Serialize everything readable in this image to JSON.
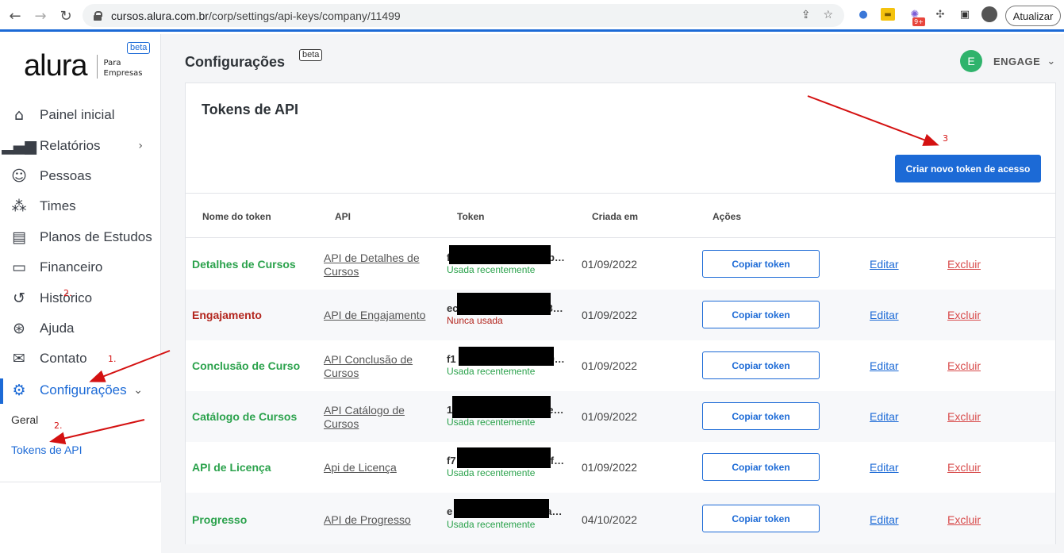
{
  "browser": {
    "url_host": "cursos.alura.com.br",
    "url_path": "/corp/settings/api-keys/company/11499",
    "update_label": "Atualizar",
    "ext_badge": "9+"
  },
  "sidebar": {
    "logo_word": "alura",
    "logo_sub_1": "Para",
    "logo_sub_2": "Empresas",
    "beta": "beta",
    "items": [
      {
        "label": "Painel inicial"
      },
      {
        "label": "Relatórios"
      },
      {
        "label": "Pessoas"
      },
      {
        "label": "Times"
      },
      {
        "label": "Planos de Estudos"
      },
      {
        "label": "Financeiro"
      },
      {
        "label": "Histórico"
      },
      {
        "label": "Ajuda"
      },
      {
        "label": "Contato"
      },
      {
        "label": "Configurações"
      }
    ],
    "sub_items": [
      {
        "label": "Geral"
      },
      {
        "label": "Tokens de API"
      }
    ]
  },
  "header": {
    "title": "Configurações",
    "beta": "beta",
    "avatar_initial": "E",
    "user_name": "ENGAGE"
  },
  "card": {
    "title": "Tokens de API",
    "create_button": "Criar novo token de acesso",
    "columns": [
      "Nome do token",
      "API",
      "Token",
      "Criada em",
      "Ações"
    ],
    "rows": [
      {
        "name": "Detalhes de Cursos",
        "api": "API de Detalhes de Cursos",
        "token_start": "f",
        "token_end": "lb…",
        "usage": "Usada recentemente",
        "date": "01/09/2022",
        "copy": "Copiar token",
        "edit": "Editar",
        "delete": "Excluir"
      },
      {
        "name": "Engajamento",
        "api": "API de Engajamento",
        "token_start": "ec",
        "token_end": "8…",
        "usage": "Nunca usada",
        "date": "01/09/2022",
        "copy": "Copiar token",
        "edit": "Editar",
        "delete": "Excluir"
      },
      {
        "name": "Conclusão de Curso",
        "api": "API Conclusão de Cursos",
        "token_start": "f1",
        "token_end": "9…",
        "usage": "Usada recentemente",
        "date": "01/09/2022",
        "copy": "Copiar token",
        "edit": "Editar",
        "delete": "Excluir"
      },
      {
        "name": "Catálogo de Cursos",
        "api": "API Catálogo de Cursos",
        "token_start": "1",
        "token_end": "e…",
        "usage": "Usada recentemente",
        "date": "01/09/2022",
        "copy": "Copiar token",
        "edit": "Editar",
        "delete": "Excluir"
      },
      {
        "name": "API de Licença",
        "api": "Api de Licença",
        "token_start": "f7",
        "token_end": "af…",
        "usage": "Usada recentemente",
        "date": "01/09/2022",
        "copy": "Copiar token",
        "edit": "Editar",
        "delete": "Excluir"
      },
      {
        "name": "Progresso",
        "api": "API de Progresso",
        "token_start": "e",
        "token_end": "a…",
        "usage": "Usada recentemente",
        "date": "04/10/2022",
        "copy": "Copiar token",
        "edit": "Editar",
        "delete": "Excluir"
      }
    ]
  },
  "annotations": {
    "one": "1.",
    "two_a": "2.",
    "two_b": "2.",
    "three": "3"
  },
  "colors": {
    "accent": "#1c6ad6",
    "used": "#2ba24c",
    "never": "#b3261e",
    "danger": "#d84b4b",
    "annotation": "#d41111"
  }
}
